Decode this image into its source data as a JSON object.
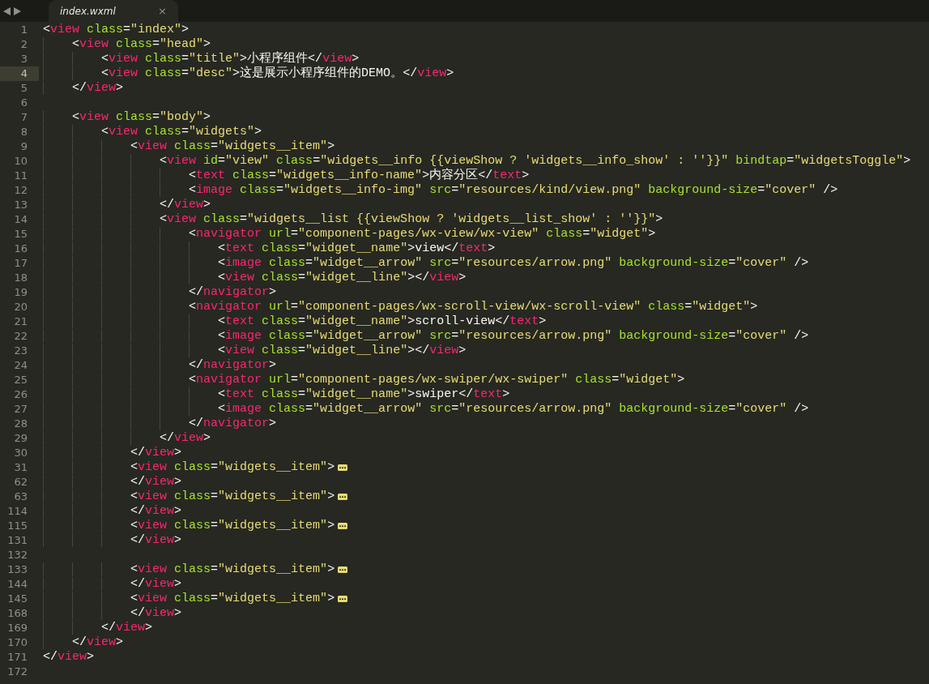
{
  "tabs": [
    {
      "label": "index.wxml",
      "close": "×",
      "selected": true
    }
  ],
  "lines": [
    {
      "number": "1",
      "current": false,
      "folded": false,
      "tokens": [
        {
          "kind": "punct",
          "text": "<"
        },
        {
          "kind": "tag",
          "text": "view "
        },
        {
          "kind": "attr",
          "text": "class"
        },
        {
          "kind": "punct",
          "text": "="
        },
        {
          "kind": "string",
          "text": "\"index\""
        },
        {
          "kind": "punct",
          "text": ">"
        }
      ]
    },
    {
      "number": "2",
      "current": false,
      "folded": false,
      "tokens": [
        {
          "kind": "punct",
          "text": "    <"
        },
        {
          "kind": "tag",
          "text": "view "
        },
        {
          "kind": "attr",
          "text": "class"
        },
        {
          "kind": "punct",
          "text": "="
        },
        {
          "kind": "string",
          "text": "\"head\""
        },
        {
          "kind": "punct",
          "text": ">"
        }
      ]
    },
    {
      "number": "3",
      "current": false,
      "folded": false,
      "tokens": [
        {
          "kind": "punct",
          "text": "        <"
        },
        {
          "kind": "tag",
          "text": "view "
        },
        {
          "kind": "attr",
          "text": "class"
        },
        {
          "kind": "punct",
          "text": "="
        },
        {
          "kind": "string",
          "text": "\"title\""
        },
        {
          "kind": "punct",
          "text": ">"
        },
        {
          "kind": "text",
          "text": "小程序组件"
        },
        {
          "kind": "punct",
          "text": "</"
        },
        {
          "kind": "tag",
          "text": "view"
        },
        {
          "kind": "punct",
          "text": ">"
        }
      ]
    },
    {
      "number": "4",
      "current": true,
      "folded": false,
      "tokens": [
        {
          "kind": "punct",
          "text": "        <"
        },
        {
          "kind": "tag",
          "text": "view "
        },
        {
          "kind": "attr",
          "text": "class"
        },
        {
          "kind": "punct",
          "text": "="
        },
        {
          "kind": "string",
          "text": "\"desc\""
        },
        {
          "kind": "punct",
          "text": ">"
        },
        {
          "kind": "text",
          "text": "这是展示小程序组件的DEMO。"
        },
        {
          "kind": "punct",
          "text": "</"
        },
        {
          "kind": "tag",
          "text": "view"
        },
        {
          "kind": "punct",
          "text": ">"
        }
      ]
    },
    {
      "number": "5",
      "current": false,
      "folded": false,
      "tokens": [
        {
          "kind": "punct",
          "text": "    </"
        },
        {
          "kind": "tag",
          "text": "view"
        },
        {
          "kind": "punct",
          "text": ">"
        }
      ]
    },
    {
      "number": "6",
      "current": false,
      "folded": false
    },
    {
      "number": "7",
      "current": false,
      "folded": false,
      "tokens": [
        {
          "kind": "punct",
          "text": "    <"
        },
        {
          "kind": "tag",
          "text": "view "
        },
        {
          "kind": "attr",
          "text": "class"
        },
        {
          "kind": "punct",
          "text": "="
        },
        {
          "kind": "string",
          "text": "\"body\""
        },
        {
          "kind": "punct",
          "text": ">"
        }
      ]
    },
    {
      "number": "8",
      "current": false,
      "folded": false,
      "tokens": [
        {
          "kind": "punct",
          "text": "        <"
        },
        {
          "kind": "tag",
          "text": "view "
        },
        {
          "kind": "attr",
          "text": "class"
        },
        {
          "kind": "punct",
          "text": "="
        },
        {
          "kind": "string",
          "text": "\"widgets\""
        },
        {
          "kind": "punct",
          "text": ">"
        }
      ]
    },
    {
      "number": "9",
      "current": false,
      "folded": false,
      "tokens": [
        {
          "kind": "punct",
          "text": "            <"
        },
        {
          "kind": "tag",
          "text": "view "
        },
        {
          "kind": "attr",
          "text": "class"
        },
        {
          "kind": "punct",
          "text": "="
        },
        {
          "kind": "string",
          "text": "\"widgets__item\""
        },
        {
          "kind": "punct",
          "text": ">"
        }
      ]
    },
    {
      "number": "10",
      "current": false,
      "folded": false,
      "tokens": [
        {
          "kind": "punct",
          "text": "                <"
        },
        {
          "kind": "tag",
          "text": "view "
        },
        {
          "kind": "attr",
          "text": "id"
        },
        {
          "kind": "punct",
          "text": "="
        },
        {
          "kind": "string",
          "text": "\"view\" "
        },
        {
          "kind": "attr",
          "text": "class"
        },
        {
          "kind": "punct",
          "text": "="
        },
        {
          "kind": "string",
          "text": "\"widgets__info {{viewShow ? 'widgets__info_show' : ''}}\" "
        },
        {
          "kind": "attr",
          "text": "bindtap"
        },
        {
          "kind": "punct",
          "text": "="
        },
        {
          "kind": "string",
          "text": "\"widgetsToggle\""
        },
        {
          "kind": "punct",
          "text": ">"
        }
      ]
    },
    {
      "number": "11",
      "current": false,
      "folded": false,
      "tokens": [
        {
          "kind": "punct",
          "text": "                    <"
        },
        {
          "kind": "tag",
          "text": "text "
        },
        {
          "kind": "attr",
          "text": "class"
        },
        {
          "kind": "punct",
          "text": "="
        },
        {
          "kind": "string",
          "text": "\"widgets__info-name\""
        },
        {
          "kind": "punct",
          "text": ">"
        },
        {
          "kind": "text",
          "text": "内容分区"
        },
        {
          "kind": "punct",
          "text": "</"
        },
        {
          "kind": "tag",
          "text": "text"
        },
        {
          "kind": "punct",
          "text": ">"
        }
      ]
    },
    {
      "number": "12",
      "current": false,
      "folded": false,
      "tokens": [
        {
          "kind": "punct",
          "text": "                    <"
        },
        {
          "kind": "tag",
          "text": "image "
        },
        {
          "kind": "attr",
          "text": "class"
        },
        {
          "kind": "punct",
          "text": "="
        },
        {
          "kind": "string",
          "text": "\"widgets__info-img\" "
        },
        {
          "kind": "attr",
          "text": "src"
        },
        {
          "kind": "punct",
          "text": "="
        },
        {
          "kind": "string",
          "text": "\"resources/kind/view.png\" "
        },
        {
          "kind": "attr",
          "text": "background-size"
        },
        {
          "kind": "punct",
          "text": "="
        },
        {
          "kind": "string",
          "text": "\"cover\""
        },
        {
          "kind": "punct",
          "text": " />"
        }
      ]
    },
    {
      "number": "13",
      "current": false,
      "folded": false,
      "tokens": [
        {
          "kind": "punct",
          "text": "                </"
        },
        {
          "kind": "tag",
          "text": "view"
        },
        {
          "kind": "punct",
          "text": ">"
        }
      ]
    },
    {
      "number": "14",
      "current": false,
      "folded": false,
      "tokens": [
        {
          "kind": "punct",
          "text": "                <"
        },
        {
          "kind": "tag",
          "text": "view "
        },
        {
          "kind": "attr",
          "text": "class"
        },
        {
          "kind": "punct",
          "text": "="
        },
        {
          "kind": "string",
          "text": "\"widgets__list {{viewShow ? 'widgets__list_show' : ''}}\""
        },
        {
          "kind": "punct",
          "text": ">"
        }
      ]
    },
    {
      "number": "15",
      "current": false,
      "folded": false,
      "tokens": [
        {
          "kind": "punct",
          "text": "                    <"
        },
        {
          "kind": "tag",
          "text": "navigator "
        },
        {
          "kind": "attr",
          "text": "url"
        },
        {
          "kind": "punct",
          "text": "="
        },
        {
          "kind": "string",
          "text": "\"component-pages/wx-view/wx-view\" "
        },
        {
          "kind": "attr",
          "text": "class"
        },
        {
          "kind": "punct",
          "text": "="
        },
        {
          "kind": "string",
          "text": "\"widget\""
        },
        {
          "kind": "punct",
          "text": ">"
        }
      ]
    },
    {
      "number": "16",
      "current": false,
      "folded": false,
      "tokens": [
        {
          "kind": "punct",
          "text": "                        <"
        },
        {
          "kind": "tag",
          "text": "text "
        },
        {
          "kind": "attr",
          "text": "class"
        },
        {
          "kind": "punct",
          "text": "="
        },
        {
          "kind": "string",
          "text": "\"widget__name\""
        },
        {
          "kind": "punct",
          "text": ">"
        },
        {
          "kind": "text",
          "text": "view"
        },
        {
          "kind": "punct",
          "text": "</"
        },
        {
          "kind": "tag",
          "text": "text"
        },
        {
          "kind": "punct",
          "text": ">"
        }
      ]
    },
    {
      "number": "17",
      "current": false,
      "folded": false,
      "tokens": [
        {
          "kind": "punct",
          "text": "                        <"
        },
        {
          "kind": "tag",
          "text": "image "
        },
        {
          "kind": "attr",
          "text": "class"
        },
        {
          "kind": "punct",
          "text": "="
        },
        {
          "kind": "string",
          "text": "\"widget__arrow\" "
        },
        {
          "kind": "attr",
          "text": "src"
        },
        {
          "kind": "punct",
          "text": "="
        },
        {
          "kind": "string",
          "text": "\"resources/arrow.png\" "
        },
        {
          "kind": "attr",
          "text": "background-size"
        },
        {
          "kind": "punct",
          "text": "="
        },
        {
          "kind": "string",
          "text": "\"cover\""
        },
        {
          "kind": "punct",
          "text": " />"
        }
      ]
    },
    {
      "number": "18",
      "current": false,
      "folded": false,
      "tokens": [
        {
          "kind": "punct",
          "text": "                        <"
        },
        {
          "kind": "tag",
          "text": "view "
        },
        {
          "kind": "attr",
          "text": "class"
        },
        {
          "kind": "punct",
          "text": "="
        },
        {
          "kind": "string",
          "text": "\"widget__line\""
        },
        {
          "kind": "punct",
          "text": "></"
        },
        {
          "kind": "tag",
          "text": "view"
        },
        {
          "kind": "punct",
          "text": ">"
        }
      ]
    },
    {
      "number": "19",
      "current": false,
      "folded": false,
      "tokens": [
        {
          "kind": "punct",
          "text": "                    </"
        },
        {
          "kind": "tag",
          "text": "navigator"
        },
        {
          "kind": "punct",
          "text": ">"
        }
      ]
    },
    {
      "number": "20",
      "current": false,
      "folded": false,
      "tokens": [
        {
          "kind": "punct",
          "text": "                    <"
        },
        {
          "kind": "tag",
          "text": "navigator "
        },
        {
          "kind": "attr",
          "text": "url"
        },
        {
          "kind": "punct",
          "text": "="
        },
        {
          "kind": "string",
          "text": "\"component-pages/wx-scroll-view/wx-scroll-view\" "
        },
        {
          "kind": "attr",
          "text": "class"
        },
        {
          "kind": "punct",
          "text": "="
        },
        {
          "kind": "string",
          "text": "\"widget\""
        },
        {
          "kind": "punct",
          "text": ">"
        }
      ]
    },
    {
      "number": "21",
      "current": false,
      "folded": false,
      "tokens": [
        {
          "kind": "punct",
          "text": "                        <"
        },
        {
          "kind": "tag",
          "text": "text "
        },
        {
          "kind": "attr",
          "text": "class"
        },
        {
          "kind": "punct",
          "text": "="
        },
        {
          "kind": "string",
          "text": "\"widget__name\""
        },
        {
          "kind": "punct",
          "text": ">"
        },
        {
          "kind": "text",
          "text": "scroll-view"
        },
        {
          "kind": "punct",
          "text": "</"
        },
        {
          "kind": "tag",
          "text": "text"
        },
        {
          "kind": "punct",
          "text": ">"
        }
      ]
    },
    {
      "number": "22",
      "current": false,
      "folded": false,
      "tokens": [
        {
          "kind": "punct",
          "text": "                        <"
        },
        {
          "kind": "tag",
          "text": "image "
        },
        {
          "kind": "attr",
          "text": "class"
        },
        {
          "kind": "punct",
          "text": "="
        },
        {
          "kind": "string",
          "text": "\"widget__arrow\" "
        },
        {
          "kind": "attr",
          "text": "src"
        },
        {
          "kind": "punct",
          "text": "="
        },
        {
          "kind": "string",
          "text": "\"resources/arrow.png\" "
        },
        {
          "kind": "attr",
          "text": "background-size"
        },
        {
          "kind": "punct",
          "text": "="
        },
        {
          "kind": "string",
          "text": "\"cover\""
        },
        {
          "kind": "punct",
          "text": " />"
        }
      ]
    },
    {
      "number": "23",
      "current": false,
      "folded": false,
      "tokens": [
        {
          "kind": "punct",
          "text": "                        <"
        },
        {
          "kind": "tag",
          "text": "view "
        },
        {
          "kind": "attr",
          "text": "class"
        },
        {
          "kind": "punct",
          "text": "="
        },
        {
          "kind": "string",
          "text": "\"widget__line\""
        },
        {
          "kind": "punct",
          "text": "></"
        },
        {
          "kind": "tag",
          "text": "view"
        },
        {
          "kind": "punct",
          "text": ">"
        }
      ]
    },
    {
      "number": "24",
      "current": false,
      "folded": false,
      "tokens": [
        {
          "kind": "punct",
          "text": "                    </"
        },
        {
          "kind": "tag",
          "text": "navigator"
        },
        {
          "kind": "punct",
          "text": ">"
        }
      ]
    },
    {
      "number": "25",
      "current": false,
      "folded": false,
      "tokens": [
        {
          "kind": "punct",
          "text": "                    <"
        },
        {
          "kind": "tag",
          "text": "navigator "
        },
        {
          "kind": "attr",
          "text": "url"
        },
        {
          "kind": "punct",
          "text": "="
        },
        {
          "kind": "string",
          "text": "\"component-pages/wx-swiper/wx-swiper\" "
        },
        {
          "kind": "attr",
          "text": "class"
        },
        {
          "kind": "punct",
          "text": "="
        },
        {
          "kind": "string",
          "text": "\"widget\""
        },
        {
          "kind": "punct",
          "text": ">"
        }
      ]
    },
    {
      "number": "26",
      "current": false,
      "folded": false,
      "tokens": [
        {
          "kind": "punct",
          "text": "                        <"
        },
        {
          "kind": "tag",
          "text": "text "
        },
        {
          "kind": "attr",
          "text": "class"
        },
        {
          "kind": "punct",
          "text": "="
        },
        {
          "kind": "string",
          "text": "\"widget__name\""
        },
        {
          "kind": "punct",
          "text": ">"
        },
        {
          "kind": "text",
          "text": "swiper"
        },
        {
          "kind": "punct",
          "text": "</"
        },
        {
          "kind": "tag",
          "text": "text"
        },
        {
          "kind": "punct",
          "text": ">"
        }
      ]
    },
    {
      "number": "27",
      "current": false,
      "folded": false,
      "tokens": [
        {
          "kind": "punct",
          "text": "                        <"
        },
        {
          "kind": "tag",
          "text": "image "
        },
        {
          "kind": "attr",
          "text": "class"
        },
        {
          "kind": "punct",
          "text": "="
        },
        {
          "kind": "string",
          "text": "\"widget__arrow\" "
        },
        {
          "kind": "attr",
          "text": "src"
        },
        {
          "kind": "punct",
          "text": "="
        },
        {
          "kind": "string",
          "text": "\"resources/arrow.png\" "
        },
        {
          "kind": "attr",
          "text": "background-size"
        },
        {
          "kind": "punct",
          "text": "="
        },
        {
          "kind": "string",
          "text": "\"cover\""
        },
        {
          "kind": "punct",
          "text": " />"
        }
      ]
    },
    {
      "number": "28",
      "current": false,
      "folded": false,
      "tokens": [
        {
          "kind": "punct",
          "text": "                    </"
        },
        {
          "kind": "tag",
          "text": "navigator"
        },
        {
          "kind": "punct",
          "text": ">"
        }
      ]
    },
    {
      "number": "29",
      "current": false,
      "folded": false,
      "tokens": [
        {
          "kind": "punct",
          "text": "                </"
        },
        {
          "kind": "tag",
          "text": "view"
        },
        {
          "kind": "punct",
          "text": ">"
        }
      ]
    },
    {
      "number": "30",
      "current": false,
      "folded": false,
      "tokens": [
        {
          "kind": "punct",
          "text": "            </"
        },
        {
          "kind": "tag",
          "text": "view"
        },
        {
          "kind": "punct",
          "text": ">"
        }
      ]
    },
    {
      "number": "31",
      "current": false,
      "folded": true,
      "tokens": [
        {
          "kind": "punct",
          "text": "            <"
        },
        {
          "kind": "tag",
          "text": "view "
        },
        {
          "kind": "attr",
          "text": "class"
        },
        {
          "kind": "punct",
          "text": "="
        },
        {
          "kind": "string",
          "text": "\"widgets__item\""
        },
        {
          "kind": "punct",
          "text": ">"
        }
      ]
    },
    {
      "number": "62",
      "current": false,
      "folded": false,
      "tokens": [
        {
          "kind": "punct",
          "text": "            </"
        },
        {
          "kind": "tag",
          "text": "view"
        },
        {
          "kind": "punct",
          "text": ">"
        }
      ]
    },
    {
      "number": "63",
      "current": false,
      "folded": true,
      "tokens": [
        {
          "kind": "punct",
          "text": "            <"
        },
        {
          "kind": "tag",
          "text": "view "
        },
        {
          "kind": "attr",
          "text": "class"
        },
        {
          "kind": "punct",
          "text": "="
        },
        {
          "kind": "string",
          "text": "\"widgets__item\""
        },
        {
          "kind": "punct",
          "text": ">"
        }
      ]
    },
    {
      "number": "114",
      "current": false,
      "folded": false,
      "tokens": [
        {
          "kind": "punct",
          "text": "            </"
        },
        {
          "kind": "tag",
          "text": "view"
        },
        {
          "kind": "punct",
          "text": ">"
        }
      ]
    },
    {
      "number": "115",
      "current": false,
      "folded": true,
      "tokens": [
        {
          "kind": "punct",
          "text": "            <"
        },
        {
          "kind": "tag",
          "text": "view "
        },
        {
          "kind": "attr",
          "text": "class"
        },
        {
          "kind": "punct",
          "text": "="
        },
        {
          "kind": "string",
          "text": "\"widgets__item\""
        },
        {
          "kind": "punct",
          "text": ">"
        }
      ]
    },
    {
      "number": "131",
      "current": false,
      "folded": false,
      "tokens": [
        {
          "kind": "punct",
          "text": "            </"
        },
        {
          "kind": "tag",
          "text": "view"
        },
        {
          "kind": "punct",
          "text": ">"
        }
      ]
    },
    {
      "number": "132",
      "current": false,
      "folded": false
    },
    {
      "number": "133",
      "current": false,
      "folded": true,
      "tokens": [
        {
          "kind": "punct",
          "text": "            <"
        },
        {
          "kind": "tag",
          "text": "view "
        },
        {
          "kind": "attr",
          "text": "class"
        },
        {
          "kind": "punct",
          "text": "="
        },
        {
          "kind": "string",
          "text": "\"widgets__item\""
        },
        {
          "kind": "punct",
          "text": ">"
        }
      ]
    },
    {
      "number": "144",
      "current": false,
      "folded": false,
      "tokens": [
        {
          "kind": "punct",
          "text": "            </"
        },
        {
          "kind": "tag",
          "text": "view"
        },
        {
          "kind": "punct",
          "text": ">"
        }
      ]
    },
    {
      "number": "145",
      "current": false,
      "folded": true,
      "tokens": [
        {
          "kind": "punct",
          "text": "            <"
        },
        {
          "kind": "tag",
          "text": "view "
        },
        {
          "kind": "attr",
          "text": "class"
        },
        {
          "kind": "punct",
          "text": "="
        },
        {
          "kind": "string",
          "text": "\"widgets__item\""
        },
        {
          "kind": "punct",
          "text": ">"
        }
      ]
    },
    {
      "number": "168",
      "current": false,
      "folded": false,
      "tokens": [
        {
          "kind": "punct",
          "text": "            </"
        },
        {
          "kind": "tag",
          "text": "view"
        },
        {
          "kind": "punct",
          "text": ">"
        }
      ]
    },
    {
      "number": "169",
      "current": false,
      "folded": false,
      "tokens": [
        {
          "kind": "punct",
          "text": "        </"
        },
        {
          "kind": "tag",
          "text": "view"
        },
        {
          "kind": "punct",
          "text": ">"
        }
      ]
    },
    {
      "number": "170",
      "current": false,
      "folded": false,
      "tokens": [
        {
          "kind": "punct",
          "text": "    </"
        },
        {
          "kind": "tag",
          "text": "view"
        },
        {
          "kind": "punct",
          "text": ">"
        }
      ]
    },
    {
      "number": "171",
      "current": false,
      "folded": false,
      "tokens": [
        {
          "kind": "punct",
          "text": "</"
        },
        {
          "kind": "tag",
          "text": "view"
        },
        {
          "kind": "punct",
          "text": ">"
        }
      ]
    },
    {
      "number": "172",
      "current": false,
      "folded": false
    }
  ]
}
